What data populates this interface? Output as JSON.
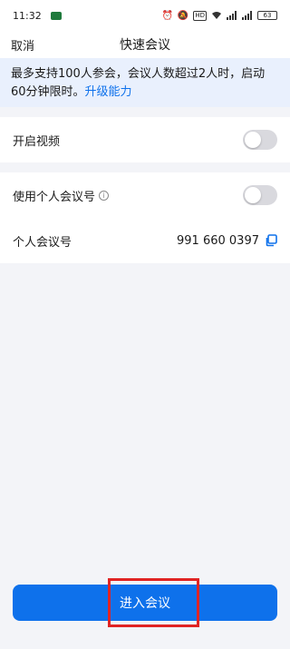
{
  "status_bar": {
    "time": "11:32",
    "battery": "63"
  },
  "nav": {
    "cancel_label": "取消",
    "title": "快速会议"
  },
  "notice": {
    "text": "最多支持100人参会，会议人数超过2人时，启动60分钟限时。",
    "link": "升级能力"
  },
  "settings": {
    "video_label": "开启视频",
    "video_on": false,
    "pmi_label": "使用个人会议号",
    "pmi_on": false,
    "meeting_id_label": "个人会议号",
    "meeting_id_value": "991 660 0397"
  },
  "join_button_label": "进入会议",
  "colors": {
    "accent": "#0e71eb",
    "highlight": "#e02424",
    "notice_bg": "#e9f0fd"
  }
}
